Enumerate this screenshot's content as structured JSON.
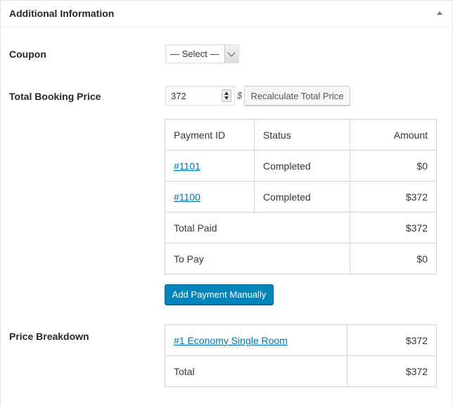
{
  "panel": {
    "title": "Additional Information",
    "toggle_icon": "arrow-up-icon"
  },
  "coupon": {
    "label": "Coupon",
    "selected": "— Select —"
  },
  "booking": {
    "label": "Total Booking Price",
    "value": "372",
    "currency": "$",
    "recalculate_label": "Recalculate Total Price"
  },
  "payments": {
    "headers": [
      "Payment ID",
      "Status",
      "Amount"
    ],
    "rows": [
      {
        "id": "#1101",
        "status": "Completed",
        "amount": "$0"
      },
      {
        "id": "#1100",
        "status": "Completed",
        "amount": "$372"
      }
    ],
    "total_paid_label": "Total Paid",
    "total_paid": "$372",
    "to_pay_label": "To Pay",
    "to_pay": "$0",
    "add_payment_label": "Add Payment Manually"
  },
  "breakdown": {
    "label": "Price Breakdown",
    "item": "#1 Economy Single Room",
    "item_price": "$372",
    "total_label": "Total",
    "total": "$372"
  },
  "colors": {
    "primary": "#0085ba",
    "link": "#0073aa"
  }
}
